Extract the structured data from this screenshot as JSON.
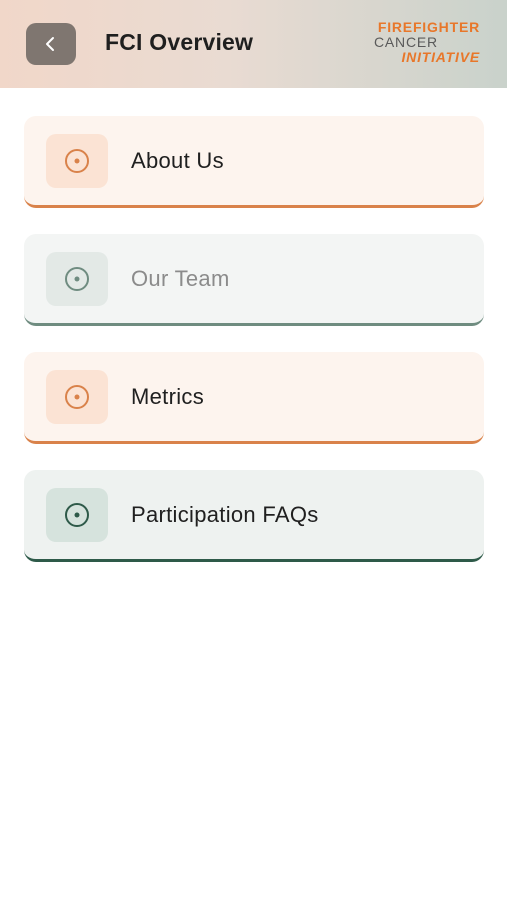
{
  "header": {
    "title": "FCI Overview",
    "back_icon": "chevron-left-icon",
    "logo": {
      "line1": "FIREFIGHTER",
      "line2": "CANCER",
      "line3": "INITIATIVE"
    }
  },
  "menu": {
    "items": [
      {
        "label": "About Us",
        "icon": "target-icon",
        "accent": "#d9824a"
      },
      {
        "label": "Our Team",
        "icon": "target-icon",
        "accent": "#6f8c80"
      },
      {
        "label": "Metrics",
        "icon": "target-icon",
        "accent": "#d9824a"
      },
      {
        "label": "Participation FAQs",
        "icon": "target-icon",
        "accent": "#2e5a49"
      }
    ]
  },
  "colors": {
    "brand_orange": "#e8772a",
    "header_gray": "#7f7670"
  }
}
